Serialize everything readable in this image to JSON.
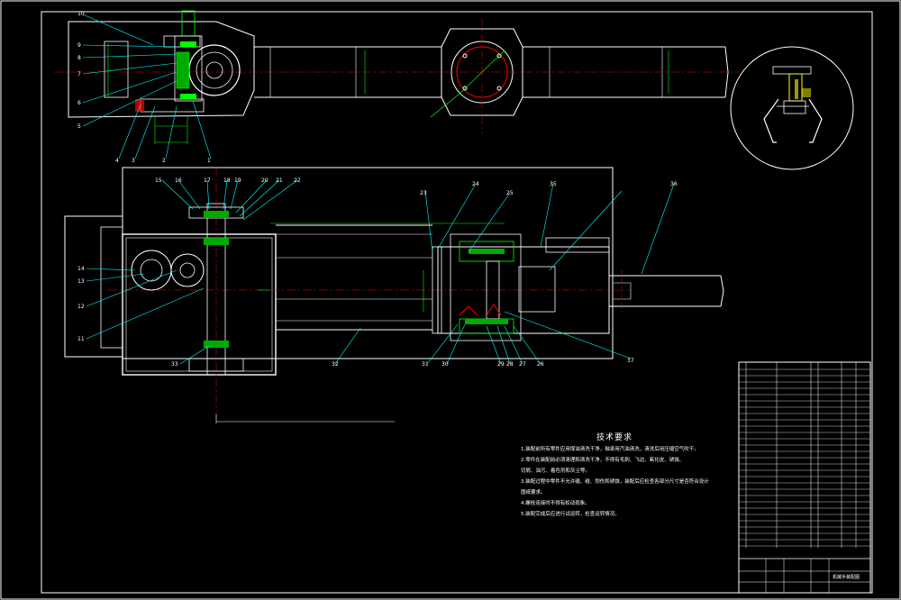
{
  "tech_requirements": {
    "title": "技术要求",
    "lines": [
      "1.装配前所有零件应用煤油清洗干净，轴承用汽油清洗，清洗后用压缩空气吹干。",
      "2.零件在装配前必须清理和清洗干净，不得有毛刺、飞边、氧化皮、锈蚀、",
      "切屑、油污、着色剂和灰尘等。",
      "3.装配过程中零件不允许磕、碰、划伤和锈蚀，装配后应检查各部分尺寸是否符合设计",
      "图纸要求。",
      "4.螺栓连接时不得有松动现象。",
      "5.装配完成后应进行试运转，检查运转情况。"
    ]
  },
  "part_numbers": {
    "top_left": [
      "10",
      "9",
      "8",
      "7",
      "6",
      "5",
      "4",
      "3",
      "2",
      "1"
    ],
    "mid_top": [
      "15",
      "16",
      "17",
      "18",
      "19",
      "20",
      "21",
      "22"
    ],
    "mid_left": [
      "14",
      "13",
      "12",
      "11"
    ],
    "mid_bottom": [
      "33",
      "32",
      "31",
      "30",
      "29",
      "28",
      "27",
      "26"
    ],
    "right_top": [
      "23",
      "24",
      "25",
      "35",
      "36"
    ],
    "right_bottom": [
      "37"
    ]
  },
  "title_block": {
    "drawing_title": "机械手装配图"
  },
  "colors": {
    "background": "#000000",
    "outline": "#ffffff",
    "component": "#00ff00",
    "dimension": "#00ff00",
    "section": "#ff0000",
    "accent": "#ffff00",
    "leader": "#00ffff"
  }
}
